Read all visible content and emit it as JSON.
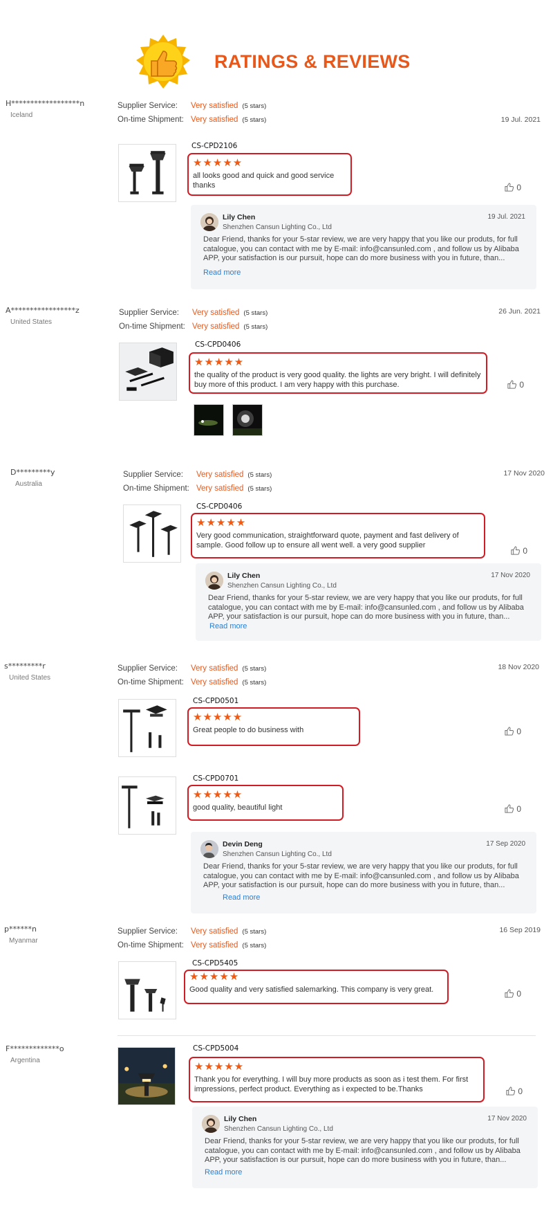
{
  "header": {
    "title": "RATINGS & REVIEWS"
  },
  "labels": {
    "supplier_service": "Supplier Service:",
    "ontime_shipment": "On-time Shipment:",
    "read_more": "Read more"
  },
  "colors": {
    "accent": "#e8581a",
    "highlight_border": "#d11c24",
    "link": "#2a7fd4",
    "reply_bg": "#f4f5f7"
  },
  "reviews": [
    {
      "name": "H******************n",
      "country": "Iceland",
      "supplier_service": "Very satisfied",
      "supplier_service_stars": "(5 stars)",
      "ontime_shipment": "Very satisfied",
      "ontime_shipment_stars": "(5 stars)",
      "date": "19 Jul. 2021",
      "products": [
        {
          "sku": "CS-CPD2106",
          "stars": "★★★★★",
          "text": "all looks good and quick and good service thanks",
          "likes": "0"
        }
      ],
      "reply": {
        "name": "Lily Chen",
        "company": "Shenzhen Cansun Lighting Co., Ltd",
        "date": "19 Jul. 2021",
        "text": "Dear Friend, thanks for your 5-star review, we are very happy that you like our produts, for full catalogue, you can contact with me by E-mail:  info@cansunled.com ,  and follow us by Alibaba APP, your satisfaction is our pursuit, hope can do more business with you in future, than..."
      }
    },
    {
      "name": "A*****************z",
      "country": "United States",
      "supplier_service": "Very satisfied",
      "supplier_service_stars": "(5 stars)",
      "ontime_shipment": "Very satisfied",
      "ontime_shipment_stars": "(5 stars)",
      "date": "26 Jun. 2021",
      "products": [
        {
          "sku": "CS-CPD0406",
          "stars": "★★★★★",
          "text": "the quality of the product is very good quality. the lights are very bright. I will definitely buy more of this product. I am very happy with this purchase.",
          "likes": "0"
        }
      ]
    },
    {
      "name": "D*********y",
      "country": "Australia",
      "supplier_service": "Very satisfied",
      "supplier_service_stars": "(5 stars)",
      "ontime_shipment": "Very satisfied",
      "ontime_shipment_stars": "(5 stars)",
      "date": "17 Nov 2020",
      "products": [
        {
          "sku": "CS-CPD0406",
          "stars": "★★★★★",
          "text": "Very good communication, straightforward quote, payment and fast delivery of sample.  Good follow up to ensure all went well.  a very good supplier",
          "likes": "0"
        }
      ],
      "reply": {
        "name": "Lily Chen",
        "company": "Shenzhen Cansun Lighting Co., Ltd",
        "date": "17 Nov 2020",
        "text": "Dear Friend, thanks for your 5-star review, we are very happy that you like our produts, for full catalogue, you can contact with me by E-mail:  info@cansunled.com ,  and follow us by Alibaba APP, your satisfaction is our pursuit, hope can do more business with you in future, than..."
      }
    },
    {
      "name": "s*********r",
      "country": "United States",
      "supplier_service": "Very satisfied",
      "supplier_service_stars": "(5 stars)",
      "ontime_shipment": "Very satisfied",
      "ontime_shipment_stars": "(5 stars)",
      "date": "18 Nov 2020",
      "products": [
        {
          "sku": "CS-CPD0501",
          "stars": "★★★★★",
          "text": "Great people to do business with",
          "likes": "0"
        },
        {
          "sku": "CS-CPD0701",
          "stars": "★★★★★",
          "text": "good quality, beautiful light",
          "likes": "0"
        }
      ],
      "reply": {
        "name": "Devin Deng",
        "company": "Shenzhen Cansun Lighting Co., Ltd",
        "date": "17 Sep 2020",
        "text": "Dear Friend, thanks for your 5-star review, we are very happy that you like our produts, for full catalogue, you can contact with me by E-mail:  info@cansunled.com ,  and follow us by Alibaba APP, your satisfaction is our pursuit, hope can do more business with you in future, than..."
      }
    },
    {
      "name": "p******n",
      "country": "Myanmar",
      "supplier_service": "Very satisfied",
      "supplier_service_stars": "(5 stars)",
      "ontime_shipment": "Very satisfied",
      "ontime_shipment_stars": "(5 stars)",
      "date": "16 Sep 2019",
      "products": [
        {
          "sku": "CS-CPD5405",
          "stars": "★★★★★",
          "text": "Good quality and very satisfied salemarking. This company is very great.",
          "likes": "0"
        }
      ]
    },
    {
      "name": "F*************o",
      "country": "Argentina",
      "products": [
        {
          "sku": "CS-CPD5004",
          "stars": "★★★★★",
          "text": "Thank you for everything. I will buy more products as soon as i test them. For first impressions, perfect product. Everything as i expected to be.Thanks",
          "likes": "0"
        }
      ],
      "reply": {
        "name": "Lily Chen",
        "company": "Shenzhen Cansun Lighting Co., Ltd",
        "date": "17 Nov 2020",
        "text": "Dear Friend, thanks for your 5-star review, we are very happy that you like our produts, for full catalogue, you can contact with me by E-mail:  info@cansunled.com ,  and follow us by Alibaba APP, your satisfaction is our pursuit, hope can do more business with you in future, than..."
      }
    }
  ]
}
